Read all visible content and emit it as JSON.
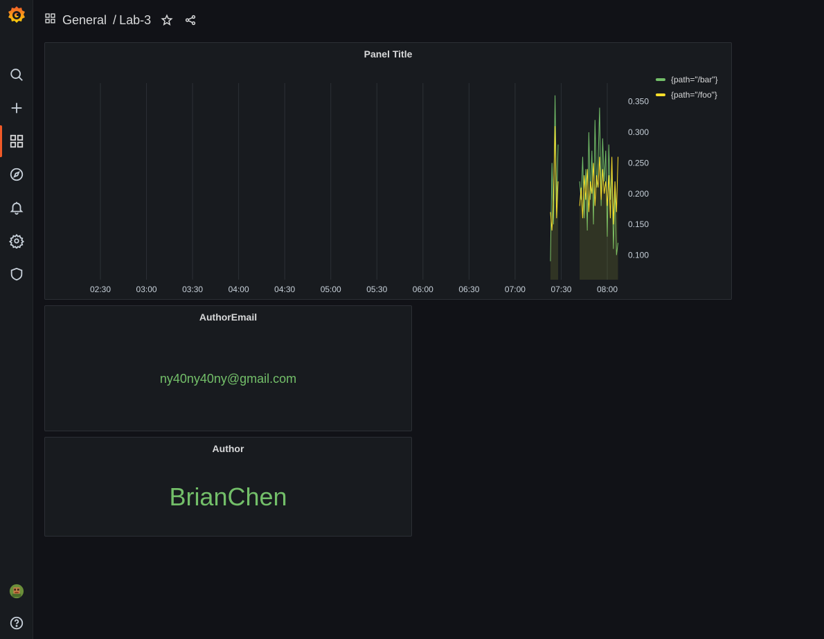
{
  "breadcrumb": {
    "folder": "General",
    "separator": "/",
    "dashboard": "Lab-3"
  },
  "sidebar": {
    "items": [
      {
        "name": "search-icon"
      },
      {
        "name": "plus-icon"
      },
      {
        "name": "dashboards-icon",
        "active": true
      },
      {
        "name": "compass-icon"
      },
      {
        "name": "bell-icon"
      },
      {
        "name": "gear-icon"
      },
      {
        "name": "shield-icon"
      }
    ],
    "bottom": [
      {
        "name": "avatar"
      },
      {
        "name": "help-icon"
      }
    ]
  },
  "colors": {
    "accent": "#f05a28",
    "bar_series": "#73bf69",
    "foo_series": "#fade2a",
    "stat_value": "#73bf69"
  },
  "panels": {
    "graph": {
      "title": "Panel Title"
    },
    "email": {
      "title": "AuthorEmail",
      "value": "ny40ny40ny@gmail.com"
    },
    "author": {
      "title": "Author",
      "value": "BrianChen"
    }
  },
  "chart_data": {
    "type": "line",
    "title": "Panel Title",
    "xlabel": "",
    "ylabel": "",
    "x_ticks": [
      "02:30",
      "03:00",
      "03:30",
      "04:00",
      "04:30",
      "05:00",
      "05:30",
      "06:00",
      "06:30",
      "07:00",
      "07:30",
      "08:00"
    ],
    "y_ticks": [
      "0.350",
      "0.300",
      "0.250",
      "0.200",
      "0.150",
      "0.100"
    ],
    "ylim": [
      0.06,
      0.38
    ],
    "grid": "vertical",
    "legend_position": "top-right",
    "series": [
      {
        "name": "{path=\"/bar\"}",
        "color": "#73bf69",
        "points": [
          [
            "07:23",
            0.09
          ],
          [
            "07:24",
            0.25
          ],
          [
            "07:25",
            0.15
          ],
          [
            "07:26",
            0.36
          ],
          [
            "07:27",
            0.18
          ],
          [
            "07:28",
            0.28
          ],
          [
            "07:42",
            0.22
          ],
          [
            "07:43",
            0.19
          ],
          [
            "07:44",
            0.26
          ],
          [
            "07:45",
            0.16
          ],
          [
            "07:46",
            0.24
          ],
          [
            "07:47",
            0.14
          ],
          [
            "07:48",
            0.3
          ],
          [
            "07:49",
            0.19
          ],
          [
            "07:50",
            0.27
          ],
          [
            "07:51",
            0.15
          ],
          [
            "07:52",
            0.32
          ],
          [
            "07:53",
            0.21
          ],
          [
            "07:54",
            0.25
          ],
          [
            "07:55",
            0.34
          ],
          [
            "07:56",
            0.18
          ],
          [
            "07:57",
            0.29
          ],
          [
            "07:58",
            0.22
          ],
          [
            "07:59",
            0.27
          ],
          [
            "08:00",
            0.13
          ],
          [
            "08:01",
            0.28
          ],
          [
            "08:02",
            0.19
          ],
          [
            "08:03",
            0.24
          ],
          [
            "08:04",
            0.11
          ],
          [
            "08:05",
            0.21
          ],
          [
            "08:06",
            0.1
          ],
          [
            "08:07",
            0.12
          ]
        ]
      },
      {
        "name": "{path=\"/foo\"}",
        "color": "#fade2a",
        "points": [
          [
            "07:23",
            0.17
          ],
          [
            "07:24",
            0.14
          ],
          [
            "07:25",
            0.2
          ],
          [
            "07:26",
            0.31
          ],
          [
            "07:27",
            0.16
          ],
          [
            "07:28",
            0.22
          ],
          [
            "07:42",
            0.18
          ],
          [
            "07:43",
            0.21
          ],
          [
            "07:44",
            0.16
          ],
          [
            "07:45",
            0.23
          ],
          [
            "07:46",
            0.19
          ],
          [
            "07:47",
            0.24
          ],
          [
            "07:48",
            0.17
          ],
          [
            "07:49",
            0.22
          ],
          [
            "07:50",
            0.2
          ],
          [
            "07:51",
            0.25
          ],
          [
            "07:52",
            0.18
          ],
          [
            "07:53",
            0.23
          ],
          [
            "07:54",
            0.21
          ],
          [
            "07:55",
            0.26
          ],
          [
            "07:56",
            0.19
          ],
          [
            "07:57",
            0.24
          ],
          [
            "07:58",
            0.2
          ],
          [
            "07:59",
            0.22
          ],
          [
            "08:00",
            0.18
          ],
          [
            "08:01",
            0.23
          ],
          [
            "08:02",
            0.16
          ],
          [
            "08:03",
            0.26
          ],
          [
            "08:04",
            0.15
          ],
          [
            "08:05",
            0.22
          ],
          [
            "08:06",
            0.17
          ],
          [
            "08:07",
            0.26
          ]
        ]
      }
    ]
  }
}
